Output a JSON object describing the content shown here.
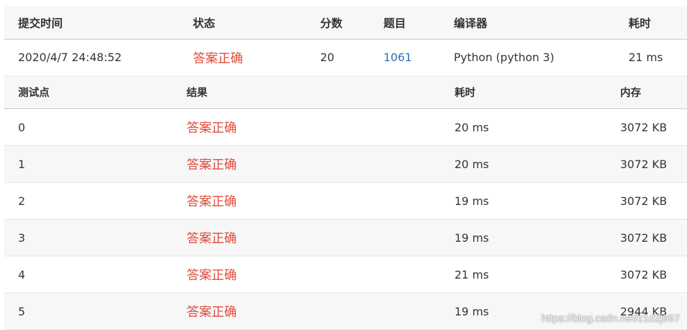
{
  "submission": {
    "headers": {
      "submit_time": "提交时间",
      "status": "状态",
      "score": "分数",
      "problem": "题目",
      "compiler": "编译器",
      "time": "耗时"
    },
    "row": {
      "submit_time": "2020/4/7 24:48:52",
      "status": "答案正确",
      "score": "20",
      "problem": "1061",
      "compiler": "Python (python 3)",
      "time": "21 ms"
    }
  },
  "testpoints": {
    "headers": {
      "point": "测试点",
      "result": "结果",
      "time": "耗时",
      "memory": "内存"
    },
    "rows": [
      {
        "point": "0",
        "result": "答案正确",
        "time": "20 ms",
        "memory": "3072 KB"
      },
      {
        "point": "1",
        "result": "答案正确",
        "time": "20 ms",
        "memory": "3072 KB"
      },
      {
        "point": "2",
        "result": "答案正确",
        "time": "19 ms",
        "memory": "3072 KB"
      },
      {
        "point": "3",
        "result": "答案正确",
        "time": "19 ms",
        "memory": "3072 KB"
      },
      {
        "point": "4",
        "result": "答案正确",
        "time": "21 ms",
        "memory": "3072 KB"
      },
      {
        "point": "5",
        "result": "答案正确",
        "time": "19 ms",
        "memory": "2944 KB"
      }
    ]
  },
  "watermark": "https://blog.csdn.net/z1d2j997",
  "colors": {
    "accepted": "#e04a3a",
    "link": "#2d6fb4",
    "header_bg": "#f7f7f7"
  }
}
